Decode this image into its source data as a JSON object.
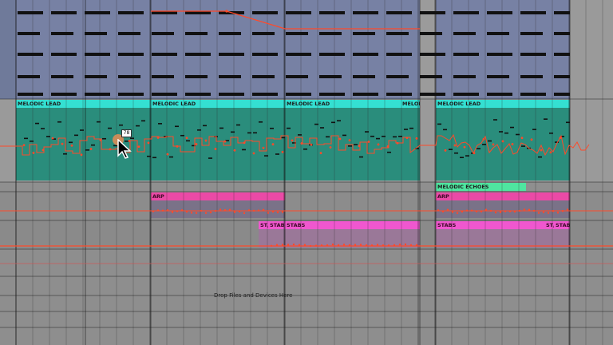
{
  "colors": {
    "lead_clip": "#2a8d7c",
    "lead_header": "#34e0d2",
    "arp_header": "#ea4aa6",
    "stabs_header": "#f057cf",
    "echoes": "#4fe6a0",
    "automation": "#ff4a2a"
  },
  "tracks": {
    "melodic_lead": {
      "clips": [
        "MELODIC LEAD",
        "MELODIC LEAD",
        "MELODIC LEAD",
        "MELODIC LEAD",
        "MELODI",
        "MELODIC LEAD"
      ]
    },
    "melodic_echoes": {
      "clips": [
        "MELODIC ECHOES"
      ]
    },
    "arp": {
      "clips": [
        "ARP",
        "ARP"
      ]
    },
    "stabs": {
      "clips": [
        "ST/",
        "STABS",
        "STABS",
        "STABS",
        "ST/",
        "STABS"
      ]
    }
  },
  "drop_hint": "Drop Files and Devices Here",
  "cursor": {
    "velocity_value": "78",
    "icon": "arrow-cursor-icon"
  }
}
